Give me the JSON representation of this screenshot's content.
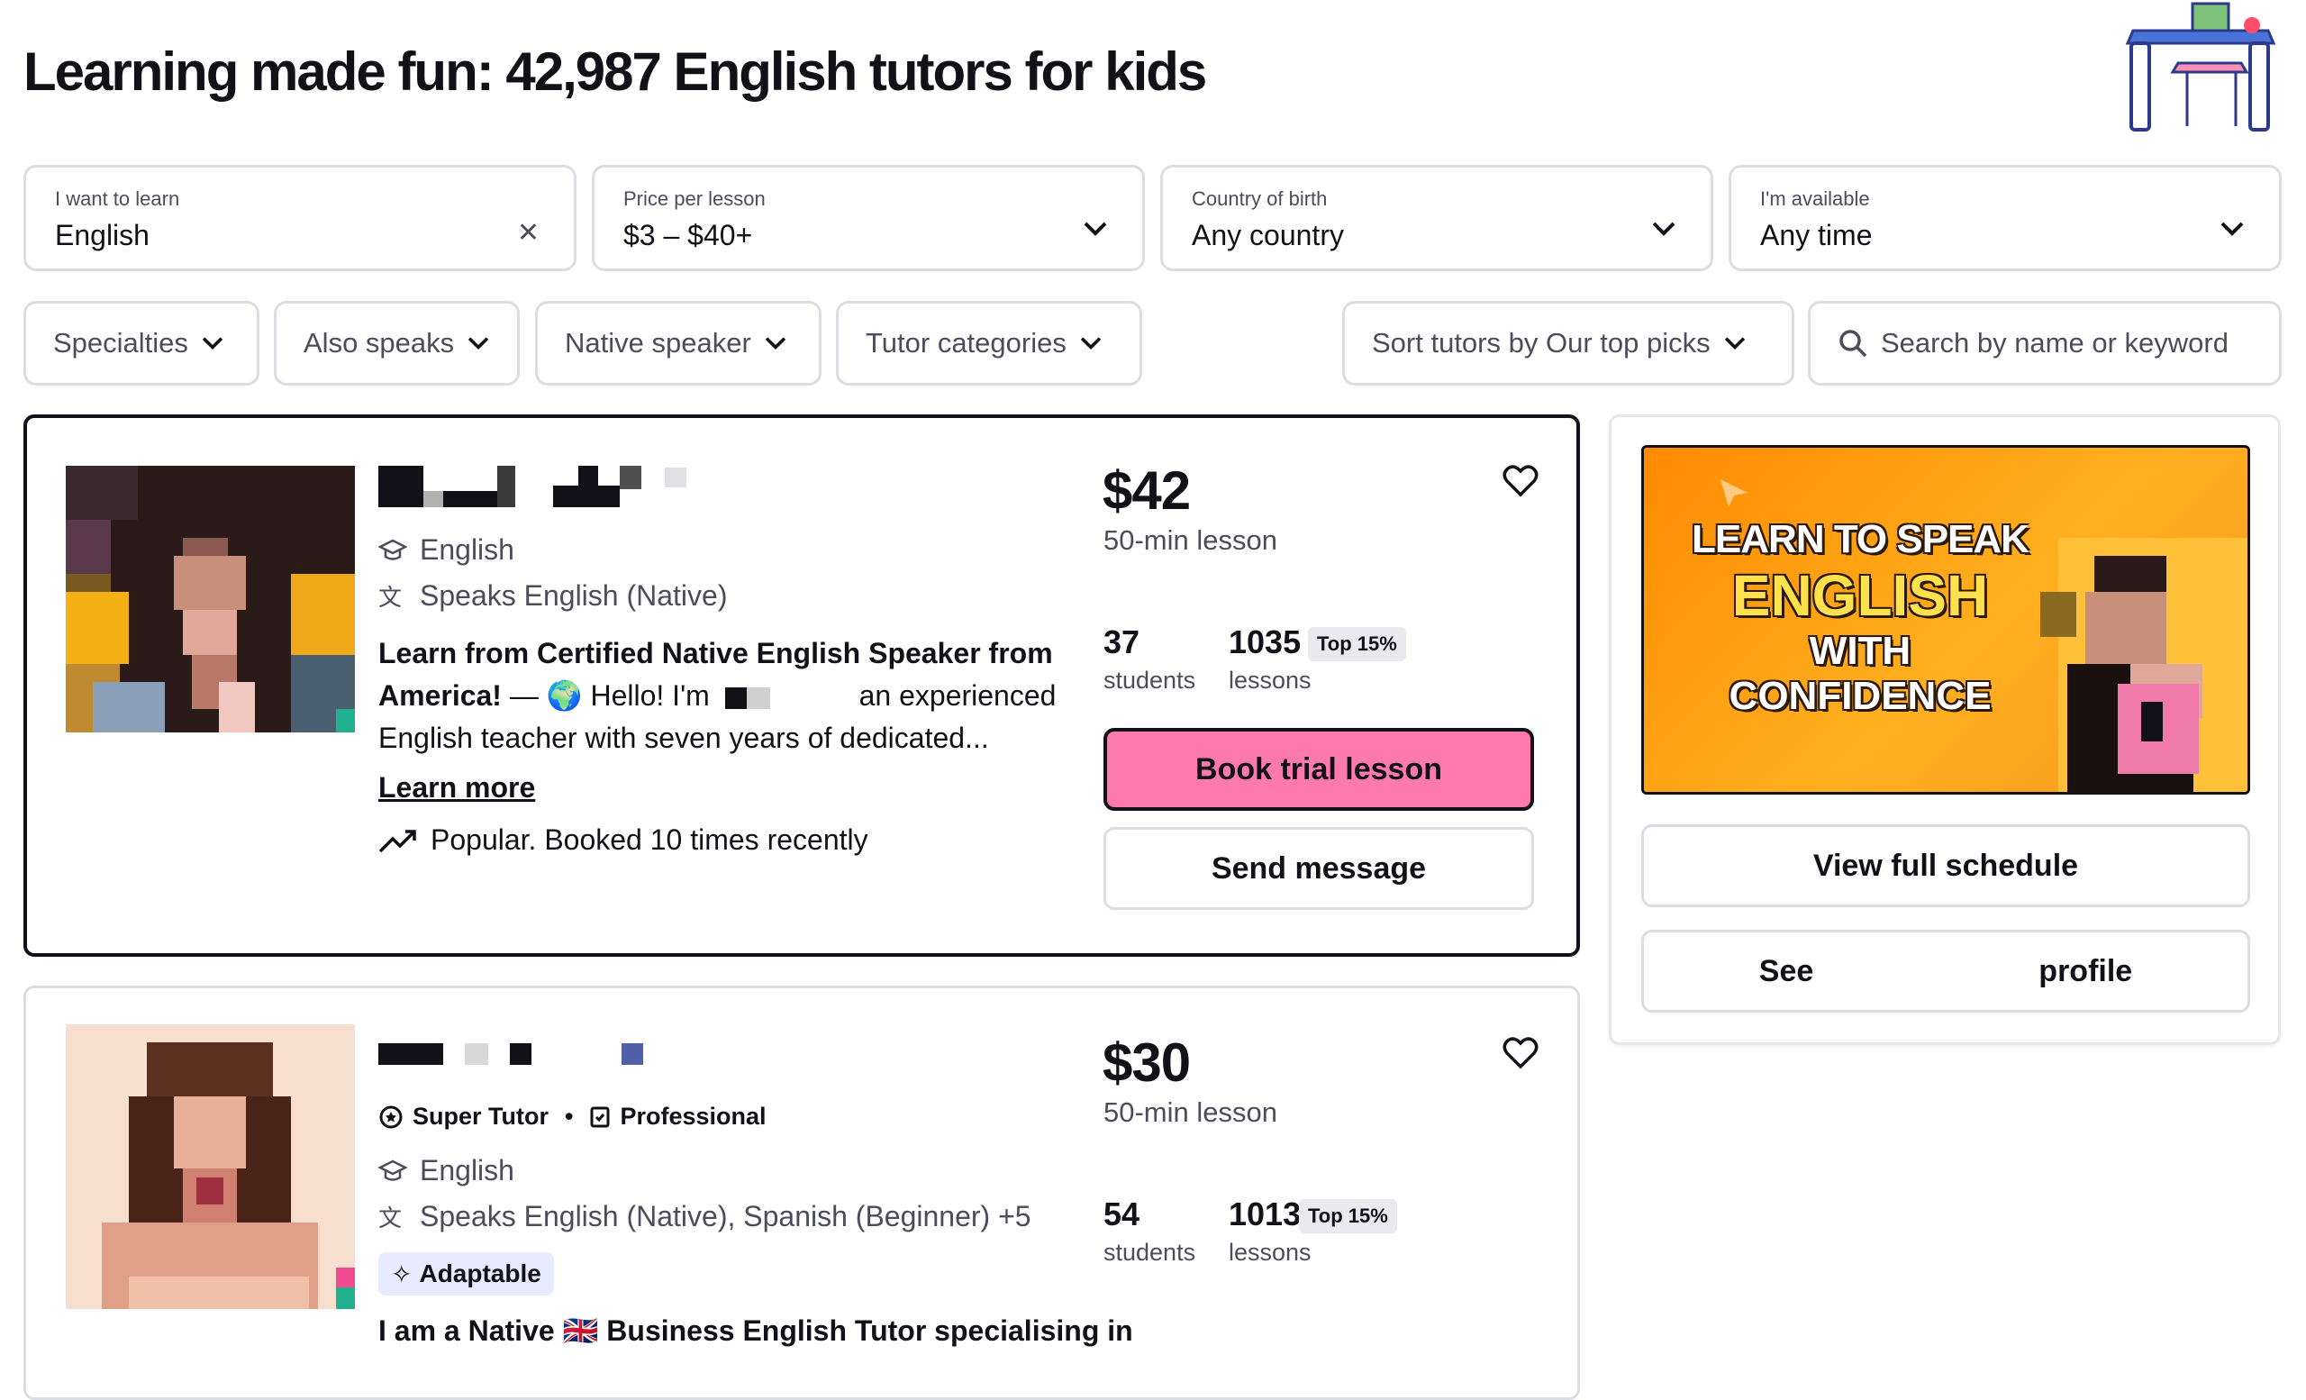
{
  "header": {
    "title": "Learning made fun: 42,987 English tutors for kids"
  },
  "filters": [
    {
      "label": "I want to learn",
      "value": "English",
      "control": "clear"
    },
    {
      "label": "Price per lesson",
      "value": "$3 – $40+",
      "control": "dropdown"
    },
    {
      "label": "Country of birth",
      "value": "Any country",
      "control": "dropdown"
    },
    {
      "label": "I'm available",
      "value": "Any time",
      "control": "dropdown"
    }
  ],
  "pills": {
    "specialties": "Specialties",
    "also_speaks": "Also speaks",
    "native_speaker": "Native speaker",
    "tutor_categories": "Tutor categories",
    "sort": "Sort tutors by Our top picks",
    "search_placeholder": "Search by name or keyword"
  },
  "tutors": [
    {
      "subject": "English",
      "speaks": "Speaks English (Native)",
      "headline": "Learn from Certified Native English Speaker from America!",
      "desc_a": "— 🌍 Hello! I'm",
      "desc_b": "an experienced",
      "desc_c": "English teacher with seven years of dedicated...",
      "learn_more": "Learn more",
      "popular": "Popular. Booked 10 times recently",
      "price": "$42",
      "lesson_length": "50-min lesson",
      "students": "37",
      "students_label": "students",
      "lessons": "1035",
      "lessons_label": "lessons",
      "top_badge": "Top 15%",
      "book_label": "Book trial lesson",
      "message_label": "Send message"
    },
    {
      "super_tutor": "Super Tutor",
      "professional": "Professional",
      "subject": "English",
      "speaks": "Speaks English (Native), Spanish (Beginner) +5",
      "tag": "Adaptable",
      "headline": "I am a Native 🇬🇧 Business English Tutor specialising in",
      "price": "$30",
      "lesson_length": "50-min lesson",
      "students": "54",
      "students_label": "students",
      "lessons": "1013",
      "lessons_label": "lessons",
      "top_badge": "Top 15%"
    }
  ],
  "video": {
    "line1": "LEARN TO SPEAK",
    "line2": "ENGLISH",
    "line3": "WITH",
    "line4": "CONFIDENCE"
  },
  "side": {
    "schedule_label": "View full schedule",
    "profile_a": "See",
    "profile_b": "profile"
  },
  "colors": {
    "accent": "#ff7aac",
    "border": "#dcdce5",
    "text": "#121117",
    "muted": "#4d4c5c",
    "video_bg": "#f7931e"
  }
}
